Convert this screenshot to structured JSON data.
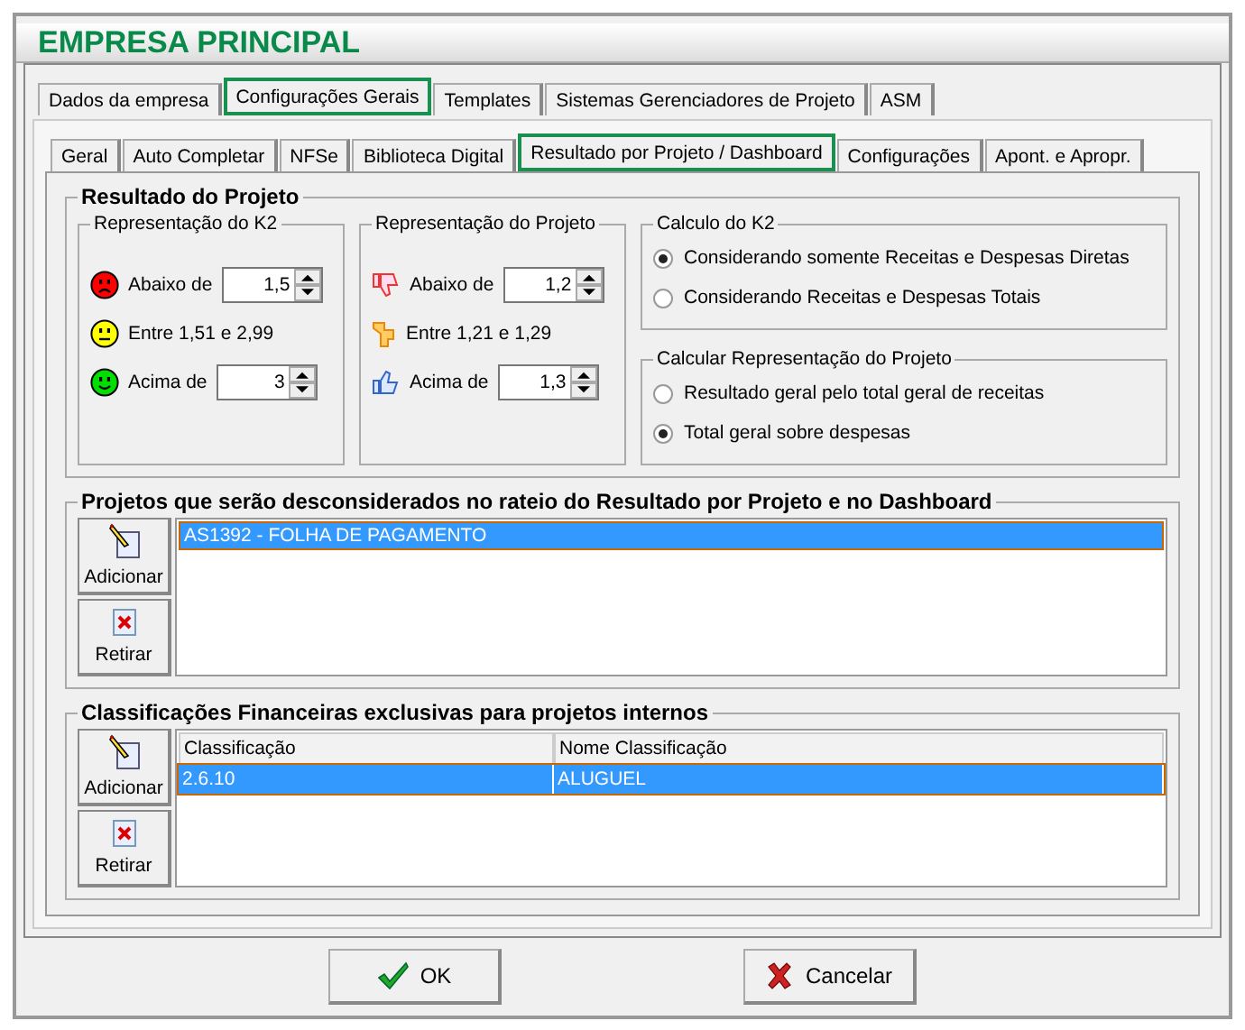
{
  "window": {
    "title": "EMPRESA PRINCIPAL"
  },
  "tabs": [
    {
      "label": "Dados da empresa",
      "selected": false
    },
    {
      "label": "Configurações Gerais",
      "selected": true
    },
    {
      "label": "Templates",
      "selected": false
    },
    {
      "label": "Sistemas Gerenciadores de Projeto",
      "selected": false
    },
    {
      "label": "ASM",
      "selected": false
    }
  ],
  "subtabs": [
    {
      "label": "Geral",
      "selected": false
    },
    {
      "label": "Auto Completar",
      "selected": false
    },
    {
      "label": "NFSe",
      "selected": false
    },
    {
      "label": "Biblioteca Digital",
      "selected": false
    },
    {
      "label": "Resultado por Projeto / Dashboard",
      "selected": true
    },
    {
      "label": "Configurações",
      "selected": false
    },
    {
      "label": "Apont. e Apropr.",
      "selected": false
    }
  ],
  "resultado": {
    "title": "Resultado do Projeto",
    "k2": {
      "title": "Representação do K2",
      "rows": [
        {
          "kind": "sad",
          "color": "#ff0000",
          "label": "Abaixo de",
          "value": "1,5"
        },
        {
          "kind": "neutral",
          "color": "#ffff00",
          "label": "Entre 1,51 e 2,99"
        },
        {
          "kind": "happy",
          "color": "#00dd00",
          "label": "Acima de",
          "value": "3"
        }
      ]
    },
    "projeto": {
      "title": "Representação do Projeto",
      "rows": [
        {
          "kind": "down",
          "label": "Abaixo de",
          "value": "1,2"
        },
        {
          "kind": "side",
          "label": "Entre 1,21 e 1,29"
        },
        {
          "kind": "up",
          "label": "Acima de",
          "value": "1,3"
        }
      ]
    },
    "calculo": {
      "title": "Calculo do K2",
      "options": [
        {
          "label": "Considerando somente Receitas e Despesas Diretas",
          "selected": true
        },
        {
          "label": "Considerando Receitas e Despesas Totais",
          "selected": false
        }
      ]
    },
    "calcular": {
      "title": "Calcular Representação do Projeto",
      "options": [
        {
          "label": "Resultado geral pelo total geral de receitas",
          "selected": false
        },
        {
          "label": "Total geral sobre despesas",
          "selected": true
        }
      ]
    }
  },
  "projetos": {
    "title": "Projetos que serão desconsiderados no rateio do Resultado por Projeto e no Dashboard",
    "buttons": [
      "Adicionar",
      "Retirar"
    ],
    "items": [
      {
        "label": "AS1392 - FOLHA DE PAGAMENTO",
        "selected": true
      }
    ]
  },
  "classificacoes": {
    "title": "Classificações Financeiras exclusivas para projetos internos",
    "buttons": [
      "Adicionar",
      "Retirar"
    ],
    "columns": [
      "Classificação",
      "Nome Classificação"
    ],
    "rows": [
      {
        "cells": [
          "2.6.10",
          "ALUGUEL"
        ],
        "selected": true
      }
    ]
  },
  "footer": {
    "ok": "OK",
    "cancel": "Cancelar"
  }
}
